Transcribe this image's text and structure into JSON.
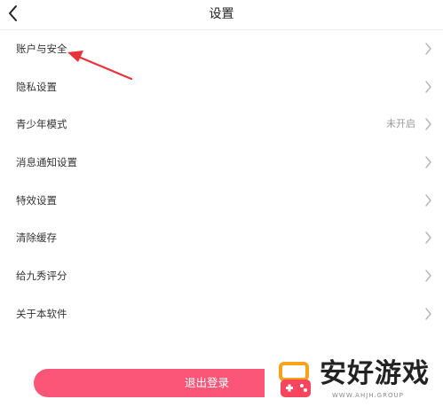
{
  "header": {
    "title": "设置",
    "back_icon": "chevron-left-icon"
  },
  "menu": {
    "items": [
      {
        "label": "账户与安全",
        "value": ""
      },
      {
        "label": "隐私设置",
        "value": ""
      },
      {
        "label": "青少年模式",
        "value": "未开启"
      },
      {
        "label": "消息通知设置",
        "value": ""
      },
      {
        "label": "特效设置",
        "value": ""
      },
      {
        "label": "清除缓存",
        "value": ""
      },
      {
        "label": "给九秀评分",
        "value": ""
      },
      {
        "label": "关于本软件",
        "value": ""
      }
    ],
    "chevron_icon": "chevron-right-icon"
  },
  "annotation": {
    "icon": "red-arrow-icon",
    "color": "#e8323c"
  },
  "logout": {
    "label": "退出登录",
    "color": "#fb5577"
  },
  "watermark": {
    "text": "安好游戏",
    "subtext": "WWW.AHJH.GROUP",
    "icon": "gamepad-logo-icon"
  }
}
